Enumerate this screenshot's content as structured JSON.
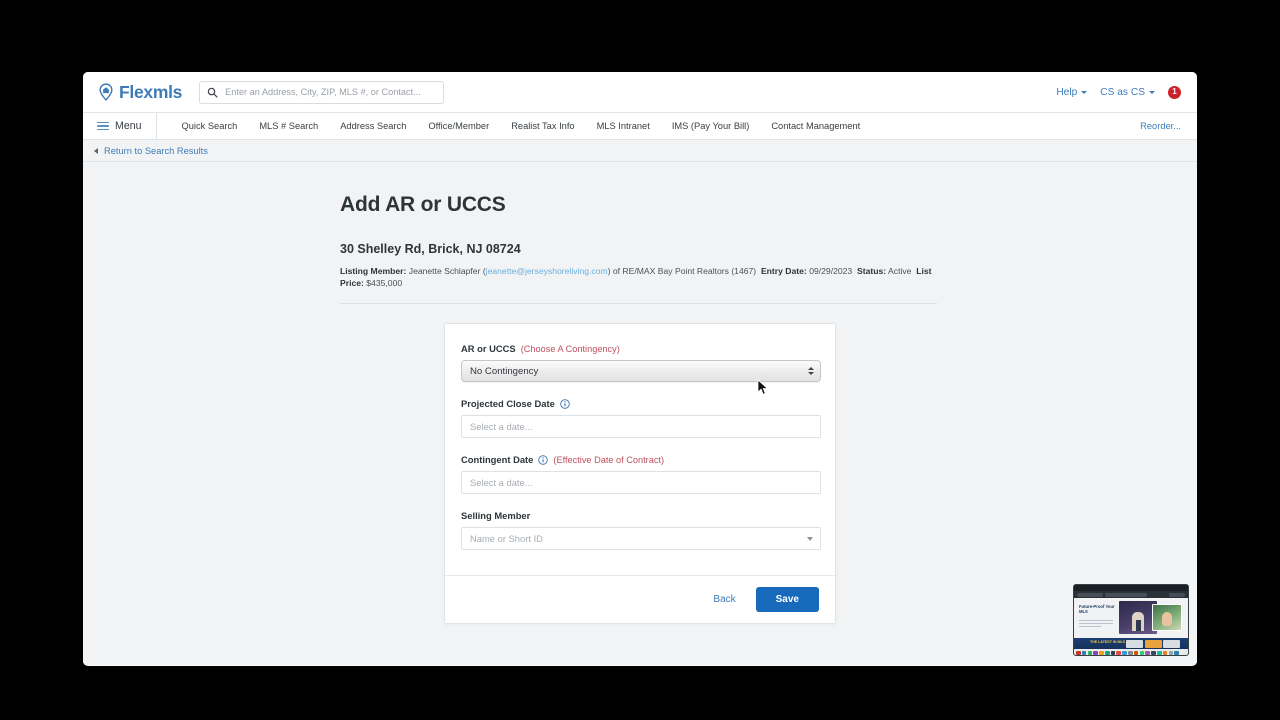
{
  "header": {
    "brand_name": "Flexmls",
    "search_placeholder": "Enter an Address, City, ZIP, MLS #, or Contact...",
    "search_value": "",
    "help_label": "Help",
    "account_label": "CS as CS",
    "notification_count": "1"
  },
  "nav": {
    "menu_label": "Menu",
    "items": [
      {
        "label": "Quick Search"
      },
      {
        "label": "MLS # Search"
      },
      {
        "label": "Address Search"
      },
      {
        "label": "Office/Member"
      },
      {
        "label": "Realist Tax Info"
      },
      {
        "label": "MLS Intranet"
      },
      {
        "label": "IMS (Pay Your Bill)"
      },
      {
        "label": "Contact Management"
      }
    ],
    "reorder_label": "Reorder..."
  },
  "breadcrumb": {
    "return_label": "Return to Search Results"
  },
  "main": {
    "page_title": "Add AR or UCCS",
    "address": "30 Shelley Rd, Brick, NJ 08724",
    "meta": {
      "listing_member_label": "Listing Member:",
      "listing_member_name": "Jeanette Schlapfer",
      "listing_member_email": "jeanette@jerseyshoreliving.com",
      "brokerage": "of RE/MAX Bay Point Realtors (1467)",
      "entry_date_label": "Entry Date:",
      "entry_date_value": "09/29/2023",
      "status_label": "Status:",
      "status_value": "Active",
      "list_price_label": "List Price:",
      "list_price_value": "$435,000"
    }
  },
  "form": {
    "ar_uccs": {
      "label": "AR or UCCS",
      "hint": "(Choose A Contingency)",
      "selected_value": "No Contingency"
    },
    "projected_close_date": {
      "label": "Projected Close Date",
      "info_icon": "info-icon",
      "placeholder": "Select a date...",
      "value": ""
    },
    "contingent_date": {
      "label": "Contingent Date",
      "info_icon": "info-icon",
      "hint": "(Effective Date of Contract)",
      "placeholder": "Select a date...",
      "value": ""
    },
    "selling_member": {
      "label": "Selling Member",
      "placeholder": "Name or Short ID",
      "value": ""
    },
    "back_label": "Back",
    "save_label": "Save"
  },
  "pip": {
    "headline": "Future-Proof Your MLS",
    "banner_text": "THE LATEST IN MLS UPDATES"
  },
  "colors": {
    "brand_blue": "#3e7cb8",
    "primary_button": "#1669bb",
    "hint_red": "#c0505f",
    "notification_red": "#cc2229",
    "page_background": "#f2f3f4"
  }
}
